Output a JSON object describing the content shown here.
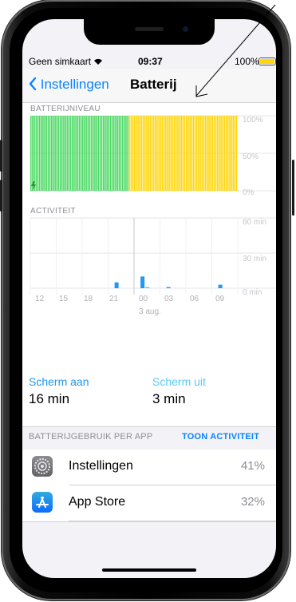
{
  "status_bar": {
    "carrier": "Geen simkaart",
    "time": "09:37",
    "battery_percent_label": "100%"
  },
  "nav": {
    "back_label": "Instellingen",
    "title": "Batterij"
  },
  "battery_level": {
    "section_label": "BATTERIJNIVEAU",
    "y_ticks": [
      "100%",
      "50%",
      "0%"
    ]
  },
  "activity": {
    "section_label": "ACTIVITEIT",
    "y_ticks": [
      "60 min",
      "30 min",
      "0 min"
    ],
    "x_ticks": [
      "12",
      "15",
      "18",
      "21",
      "00",
      "03",
      "06",
      "09"
    ],
    "date_label": "3 aug."
  },
  "chart_data": [
    {
      "type": "bar",
      "title": "BATTERIJNIVEAU",
      "ylim": [
        0,
        100
      ],
      "y_ticks": [
        "100%",
        "50%",
        "0%"
      ],
      "series": [
        {
          "name": "",
          "color": "#4cd964",
          "values": [
            100,
            100,
            100,
            100,
            100,
            100,
            100,
            100,
            100,
            100,
            100,
            100,
            100,
            100,
            100,
            100,
            100,
            100,
            100,
            100,
            100,
            100,
            100,
            100,
            100,
            100,
            100,
            100,
            100,
            100,
            100,
            100,
            100,
            100,
            100,
            100,
            100,
            100,
            100,
            100,
            100,
            100,
            100,
            100,
            100,
            100,
            100,
            100,
            100,
            100,
            100,
            100,
            100,
            100,
            100,
            100,
            100,
            100,
            100,
            100,
            100,
            100,
            100,
            100,
            100,
            100,
            100,
            100,
            100,
            100,
            100,
            100,
            100,
            100,
            100,
            100,
            100,
            100,
            100,
            100,
            100,
            100,
            100,
            100,
            100,
            100,
            100,
            100,
            100,
            100,
            100,
            100,
            100,
            100,
            100,
            100,
            100,
            100,
            100,
            100,
            100,
            100,
            100,
            100,
            100,
            100,
            100,
            100,
            100,
            100,
            100,
            100,
            100,
            100,
            100,
            100,
            100,
            100,
            100,
            100
          ]
        }
      ]
    },
    {
      "type": "bar",
      "title": "ACTIVITEIT",
      "categories": [
        "12",
        "15",
        "18",
        "21",
        "00",
        "03",
        "06",
        "09"
      ],
      "ylim": [
        0,
        60
      ],
      "series": [
        {
          "name": "Scherm aan",
          "color": "#2196f3",
          "values": [
            0,
            0,
            0,
            5,
            10,
            1,
            0,
            3
          ]
        },
        {
          "name": "Scherm uit",
          "color": "#5ac8fa",
          "values": [
            0,
            0,
            0,
            0,
            1,
            0,
            0,
            0
          ]
        }
      ]
    }
  ],
  "screen_time": {
    "on_label": "Scherm aan",
    "on_value": "16 min",
    "off_label": "Scherm uit",
    "off_value": "3 min"
  },
  "usage": {
    "header_left": "BATTERIJGEBRUIK PER APP",
    "header_right": "TOON ACTIVITEIT",
    "apps": [
      {
        "name": "Instellingen",
        "percent": "41%",
        "icon": "settings-icon"
      },
      {
        "name": "App Store",
        "percent": "32%",
        "icon": "app-store-icon"
      }
    ]
  },
  "colors": {
    "accent": "#0a84ff",
    "battery_green": "#4cd964",
    "battery_yellow": "#ffd60a"
  }
}
